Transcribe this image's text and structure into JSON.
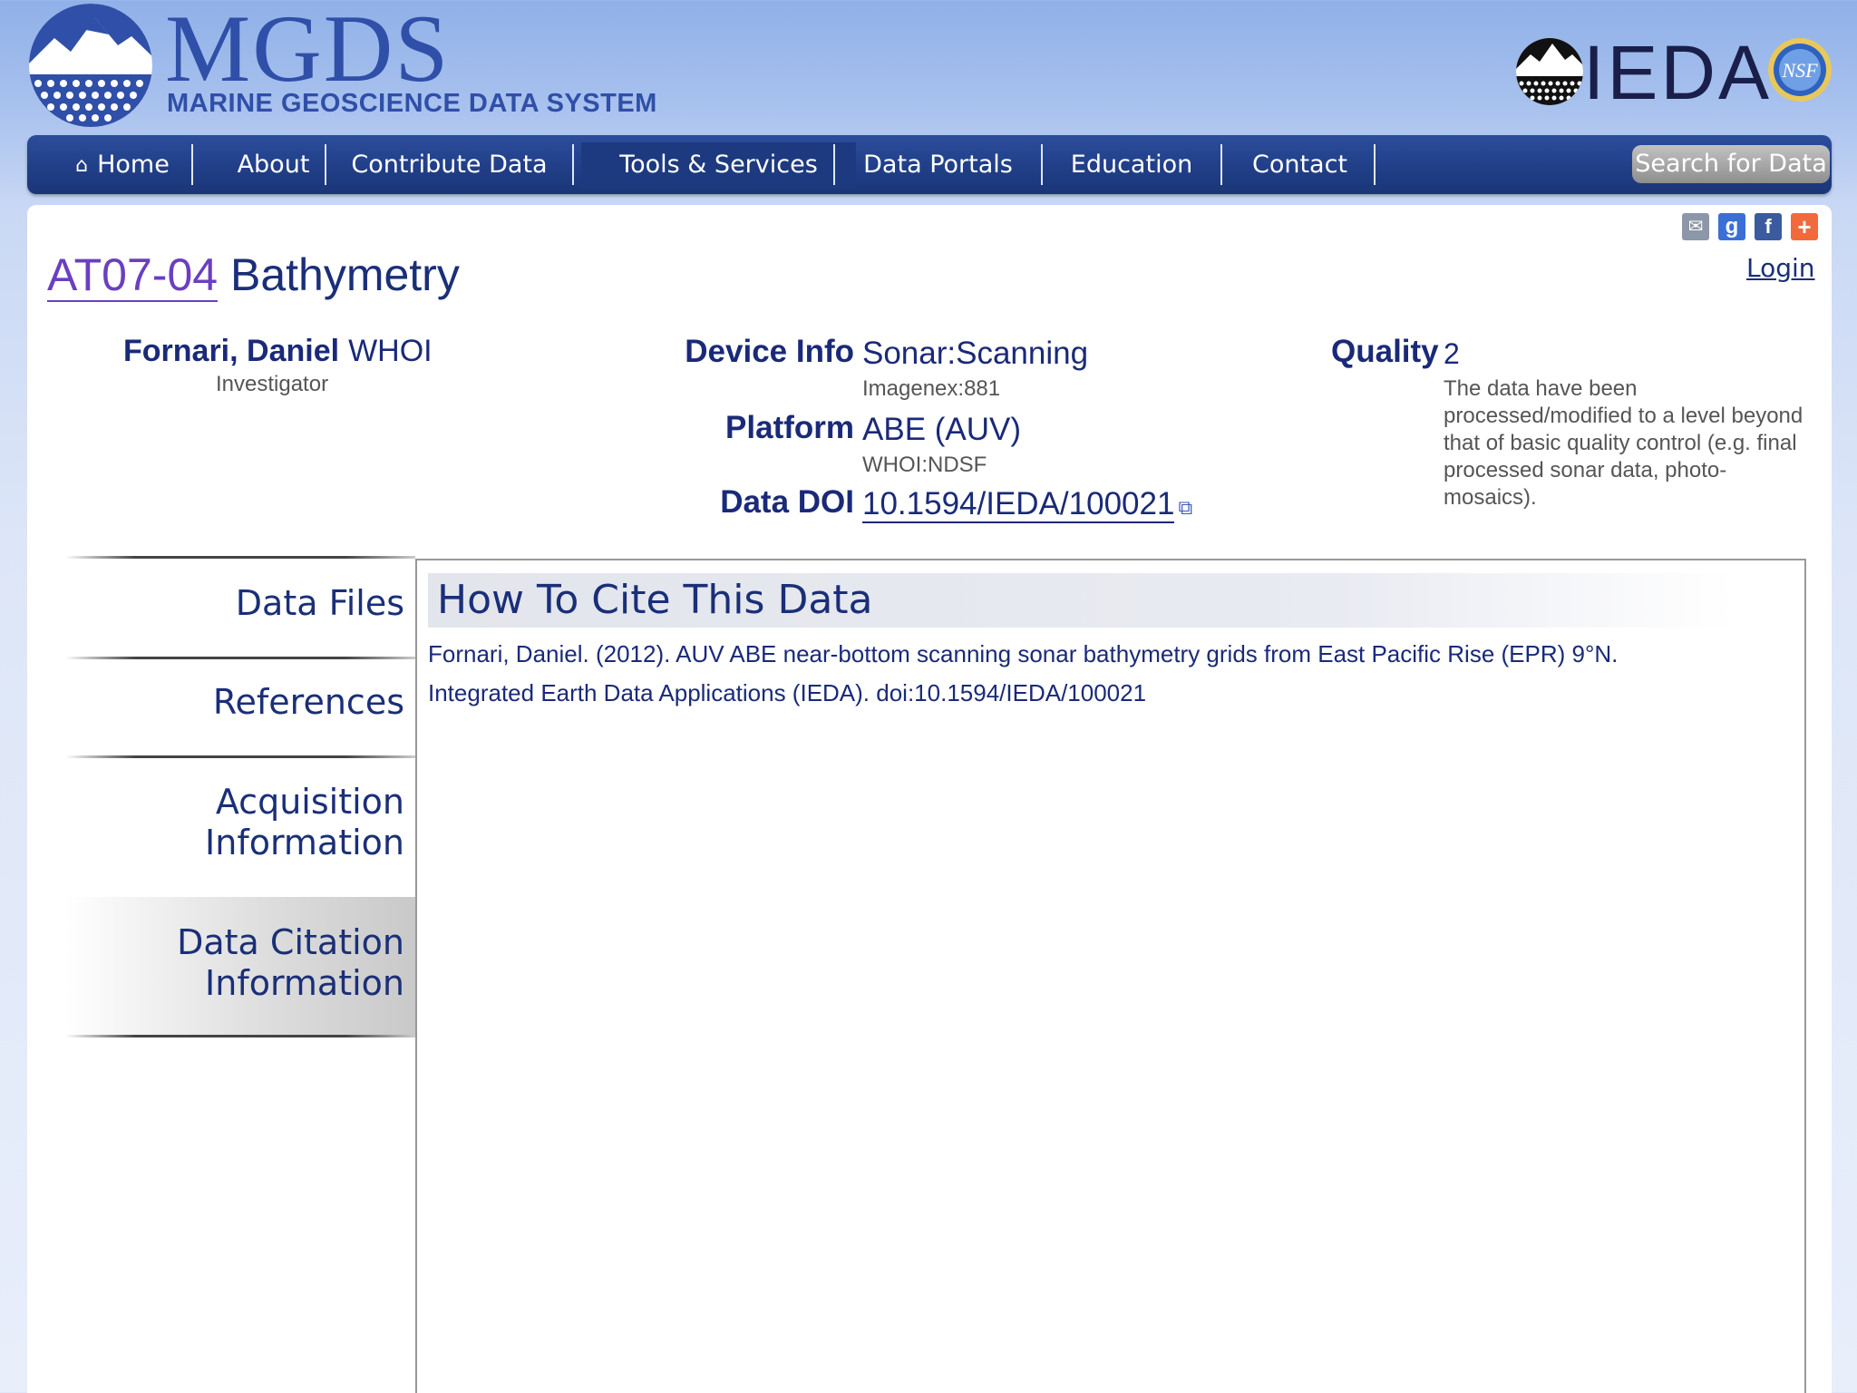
{
  "header": {
    "brand_title": "MGDS",
    "brand_subtitle": "MARINE GEOSCIENCE DATA SYSTEM",
    "partner_title": "IEDA",
    "nsf_label": "NSF"
  },
  "nav": {
    "items": [
      {
        "label": "Home"
      },
      {
        "label": "About"
      },
      {
        "label": "Contribute Data"
      },
      {
        "label": "Tools & Services"
      },
      {
        "label": "Data Portals"
      },
      {
        "label": "Education"
      },
      {
        "label": "Contact"
      }
    ],
    "active": "Tools & Services",
    "search_label": "Search for Data"
  },
  "page": {
    "login_label": "Login",
    "title_id": "AT07-04",
    "title_rest": "Bathymetry"
  },
  "investigator": {
    "name": "Fornari, Daniel",
    "org": "WHOI",
    "role": "Investigator"
  },
  "device": {
    "label": "Device Info",
    "value": "Sonar:Scanning",
    "sub": "Imagenex:881"
  },
  "platform": {
    "label": "Platform",
    "value": "ABE (AUV)",
    "sub": "WHOI:NDSF"
  },
  "doi": {
    "label": "Data DOI",
    "value": "10.1594/IEDA/100021"
  },
  "quality": {
    "label": "Quality",
    "value": "2",
    "description": "The data have been processed/modified to a level beyond that of basic quality control (e.g. final processed sonar data, photo-mosaics)."
  },
  "tabs": [
    {
      "line1": "Data Files",
      "line2": ""
    },
    {
      "line1": "References",
      "line2": ""
    },
    {
      "line1": "Acquisition",
      "line2": "Information"
    },
    {
      "line1": "Data Citation",
      "line2": "Information"
    }
  ],
  "citation": {
    "heading": "How To Cite This Data",
    "line1": "Fornari, Daniel. (2012). AUV ABE near-bottom scanning sonar bathymetry grids from East Pacific Rise (EPR) 9°N.",
    "line2": "Integrated Earth Data Applications (IEDA). doi:10.1594/IEDA/100021"
  },
  "share_icons": [
    "email-icon",
    "google-plus-icon",
    "facebook-icon",
    "add-share-icon"
  ],
  "colors": {
    "nav_bg": "#213f88",
    "brand_blue": "#2f4fa8",
    "text_navy": "#1a2a78",
    "title_id_purple": "#6a3fc0"
  }
}
